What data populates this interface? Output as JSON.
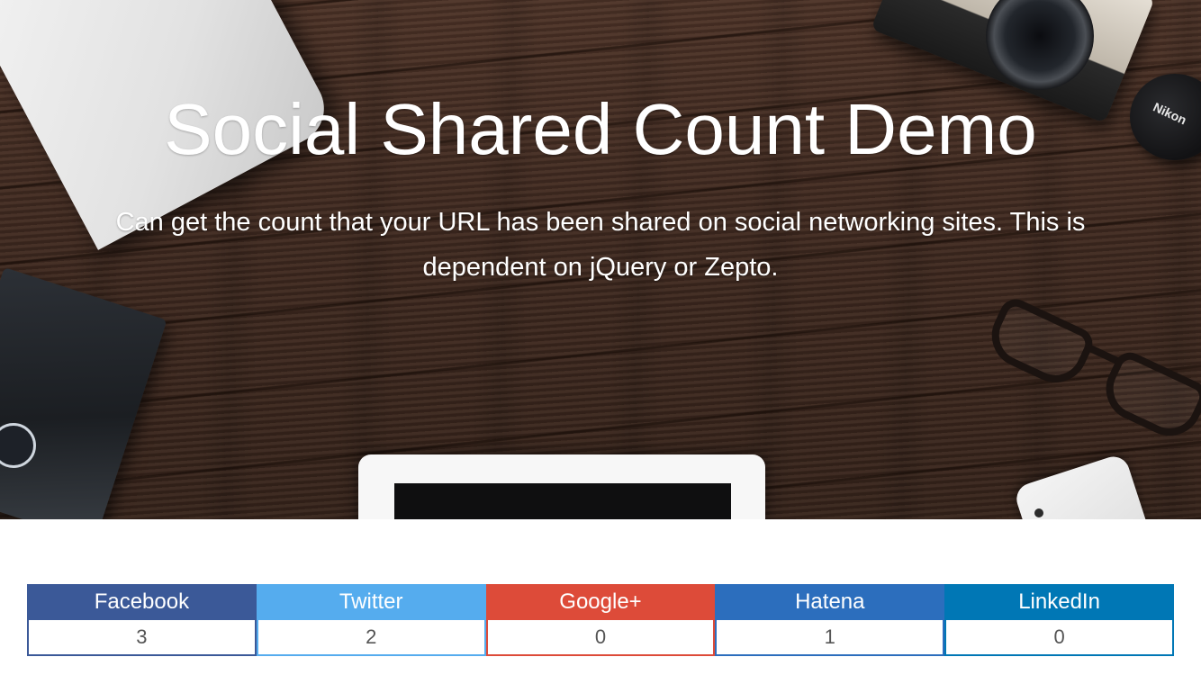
{
  "hero": {
    "title": "Social Shared Count Demo",
    "subtitle": "Can get the count that your URL has been shared on social networking sites. This is dependent on jQuery or Zepto.",
    "lens_cap_brand": "Nikon"
  },
  "share_counts": [
    {
      "service": "Facebook",
      "count": "3",
      "color": "#3b5998"
    },
    {
      "service": "Twitter",
      "count": "2",
      "color": "#55acee"
    },
    {
      "service": "Google+",
      "count": "0",
      "color": "#dd4b39"
    },
    {
      "service": "Hatena",
      "count": "1",
      "color": "#2c6ebd"
    },
    {
      "service": "LinkedIn",
      "count": "0",
      "color": "#0077b5"
    }
  ]
}
